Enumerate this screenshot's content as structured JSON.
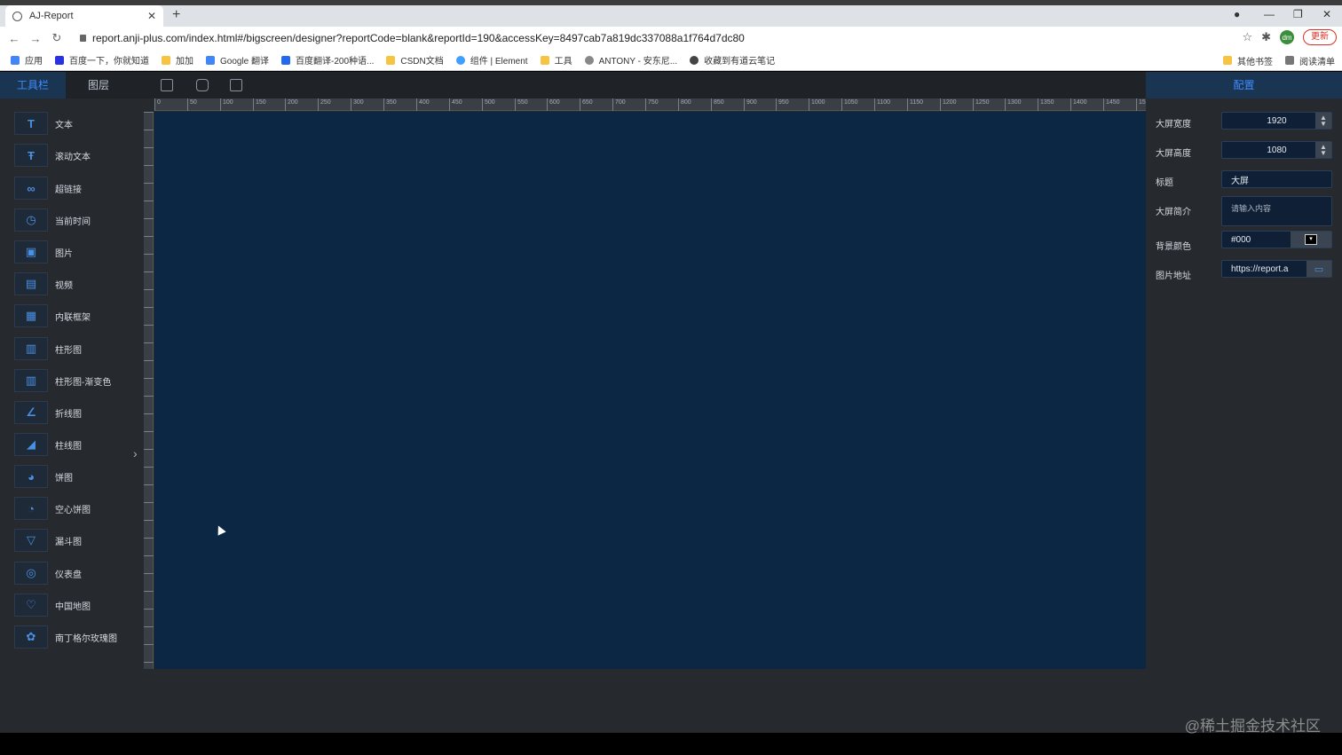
{
  "browser": {
    "tab_title": "AJ-Report",
    "url": "report.anji-plus.com/index.html#/bigscreen/designer?reportCode=blank&reportId=190&accessKey=8497cab7a819dc337088a1f764d7dc80",
    "avatar_text": "dm",
    "update_label": "更新",
    "bookmarks": [
      "应用",
      "百度一下，你就知道",
      "加加",
      "Google 翻译",
      "百度翻译-200种语...",
      "CSDN文档",
      "组件 | Element",
      "工具",
      "ANTONY - 安东尼...",
      "收藏到有道云笔记"
    ],
    "bookmarks_right": [
      "其他书签",
      "阅读清单"
    ]
  },
  "header": {
    "tab_toolbar": "工具栏",
    "tab_layers": "图层",
    "config_title": "配置"
  },
  "sidebar": {
    "items": [
      {
        "label": "文本",
        "icon": "T"
      },
      {
        "label": "滚动文本",
        "icon": "Ŧ"
      },
      {
        "label": "超链接",
        "icon": "∞"
      },
      {
        "label": "当前时间",
        "icon": "◷"
      },
      {
        "label": "图片",
        "icon": "▣"
      },
      {
        "label": "视频",
        "icon": "▤"
      },
      {
        "label": "内联框架",
        "icon": "▦"
      },
      {
        "label": "柱形图",
        "icon": "▥"
      },
      {
        "label": "柱形图-渐变色",
        "icon": "▥"
      },
      {
        "label": "折线图",
        "icon": "∠"
      },
      {
        "label": "柱线图",
        "icon": "◢"
      },
      {
        "label": "饼图",
        "icon": "◕"
      },
      {
        "label": "空心饼图",
        "icon": "◔"
      },
      {
        "label": "漏斗图",
        "icon": "▽"
      },
      {
        "label": "仪表盘",
        "icon": "◎"
      },
      {
        "label": "中国地图",
        "icon": "♡"
      },
      {
        "label": "南丁格尔玫瑰图",
        "icon": "✿"
      }
    ]
  },
  "ruler": {
    "top_labels": [
      "0",
      "50",
      "100",
      "150",
      "200",
      "250",
      "300",
      "350",
      "400",
      "450",
      "500",
      "550",
      "600",
      "650",
      "700",
      "750",
      "800",
      "850",
      "900",
      "950",
      "1000",
      "1050",
      "1100",
      "1150",
      "1200",
      "1250",
      "1300",
      "1350",
      "1400",
      "1450",
      "15"
    ]
  },
  "config": {
    "width_label": "大屏宽度",
    "width_value": "1920",
    "height_label": "大屏高度",
    "height_value": "1080",
    "title_label": "标题",
    "title_value": "大屏",
    "desc_label": "大屏简介",
    "desc_placeholder": "请输入内容",
    "bg_color_label": "背景颜色",
    "bg_color_value": "#000",
    "image_label": "图片地址",
    "image_value": "https://report.a"
  },
  "watermark": "@稀土掘金技术社区",
  "colors": {
    "canvas": "#0c2744",
    "accent": "#3f8cff",
    "panel": "#262a2f"
  }
}
